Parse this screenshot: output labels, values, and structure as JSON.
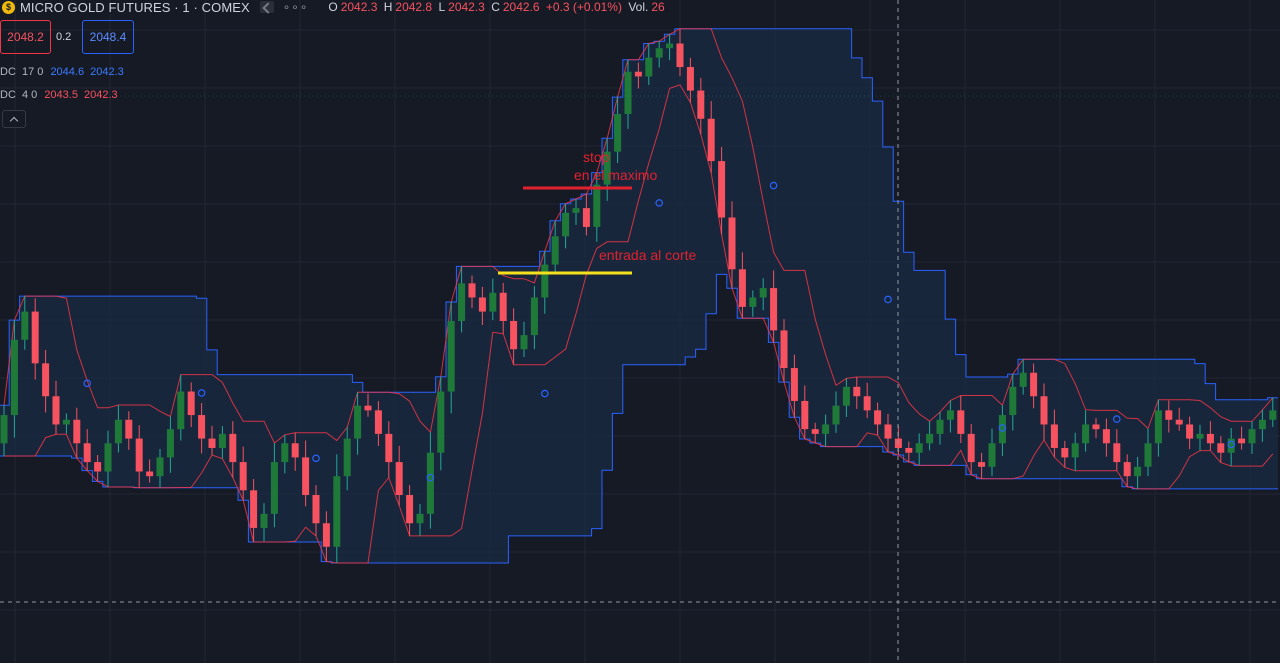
{
  "header": {
    "symbol_title": "MICRO GOLD FUTURES · 1 · COMEX",
    "more_label": "∘∘∘",
    "ohlc": [
      {
        "key": "O",
        "value": "2042.3"
      },
      {
        "key": "H",
        "value": "2042.8"
      },
      {
        "key": "L",
        "value": "2042.3"
      },
      {
        "key": "C",
        "value": "2042.6"
      },
      {
        "key": "chg",
        "value": "+0.3 (+0.01%)"
      },
      {
        "key": "Vol.",
        "value": "26"
      }
    ],
    "bid_price": "2048.2",
    "spread": "0.2",
    "ask_price": "2048.4"
  },
  "indicators": [
    {
      "name": "DC",
      "params": "17 0",
      "val1": "2044.6",
      "val2": "2042.3",
      "color": "#2962ff"
    },
    {
      "name": "DC",
      "params": "4 0",
      "val1": "2043.5",
      "val2": "2042.3",
      "color": "#f7525f"
    }
  ],
  "annotations": {
    "stop_line1": "stop",
    "stop_line2": "en el maximo",
    "entry": "entrada al corte"
  },
  "colors": {
    "background": "#161a25",
    "up_candle": "#22ab94",
    "up_candle_dark": "#1f7a3a",
    "down_candle": "#f7525f",
    "dc_long": "#2962ff",
    "dc_short": "#f23645",
    "channel_fill": "#1a2b44",
    "stop_line": "#e0222e",
    "entry_line": "#f5e11c"
  },
  "chart_data": {
    "type": "candlestick",
    "series_hint": "MICRO GOLD FUTURES 1m",
    "closes": [
      2044.0,
      2045.6,
      2046.2,
      2045.1,
      2044.4,
      2043.8,
      2043.9,
      2043.4,
      2043.0,
      2042.8,
      2043.4,
      2043.9,
      2043.5,
      2042.8,
      2042.7,
      2043.1,
      2043.7,
      2044.5,
      2044.0,
      2043.5,
      2043.3,
      2043.6,
      2043.0,
      2042.4,
      2041.6,
      2041.9,
      2043.0,
      2043.4,
      2043.1,
      2042.3,
      2041.7,
      2041.2,
      2042.7,
      2043.5,
      2044.2,
      2044.1,
      2043.6,
      2043.0,
      2042.3,
      2041.7,
      2041.9,
      2043.2,
      2044.5,
      2046.0,
      2046.8,
      2046.5,
      2046.2,
      2046.6,
      2046.0,
      2045.4,
      2045.7,
      2046.5,
      2047.2,
      2047.8,
      2048.3,
      2048.4,
      2048.0,
      2048.9,
      2049.6,
      2050.4,
      2051.3,
      2051.2,
      2051.6,
      2051.8,
      2051.9,
      2051.4,
      2050.9,
      2050.3,
      2049.4,
      2048.2,
      2047.1,
      2046.3,
      2046.5,
      2046.7,
      2045.8,
      2045.0,
      2044.3,
      2043.7,
      2043.6,
      2043.8,
      2044.2,
      2044.6,
      2044.4,
      2044.1,
      2043.8,
      2043.5,
      2043.3,
      2043.2,
      2043.4,
      2043.6,
      2043.9,
      2044.1,
      2043.6,
      2043.0,
      2042.9,
      2043.4,
      2044.0,
      2044.6,
      2044.9,
      2044.4,
      2043.8,
      2043.3,
      2043.1,
      2043.4,
      2043.8,
      2043.7,
      2043.4,
      2043.0,
      2042.7,
      2042.9,
      2043.4,
      2044.1,
      2043.9,
      2043.8,
      2043.5,
      2043.6,
      2043.4,
      2043.2,
      2043.5,
      2043.4,
      2043.7,
      2043.9,
      2044.1
    ]
  }
}
